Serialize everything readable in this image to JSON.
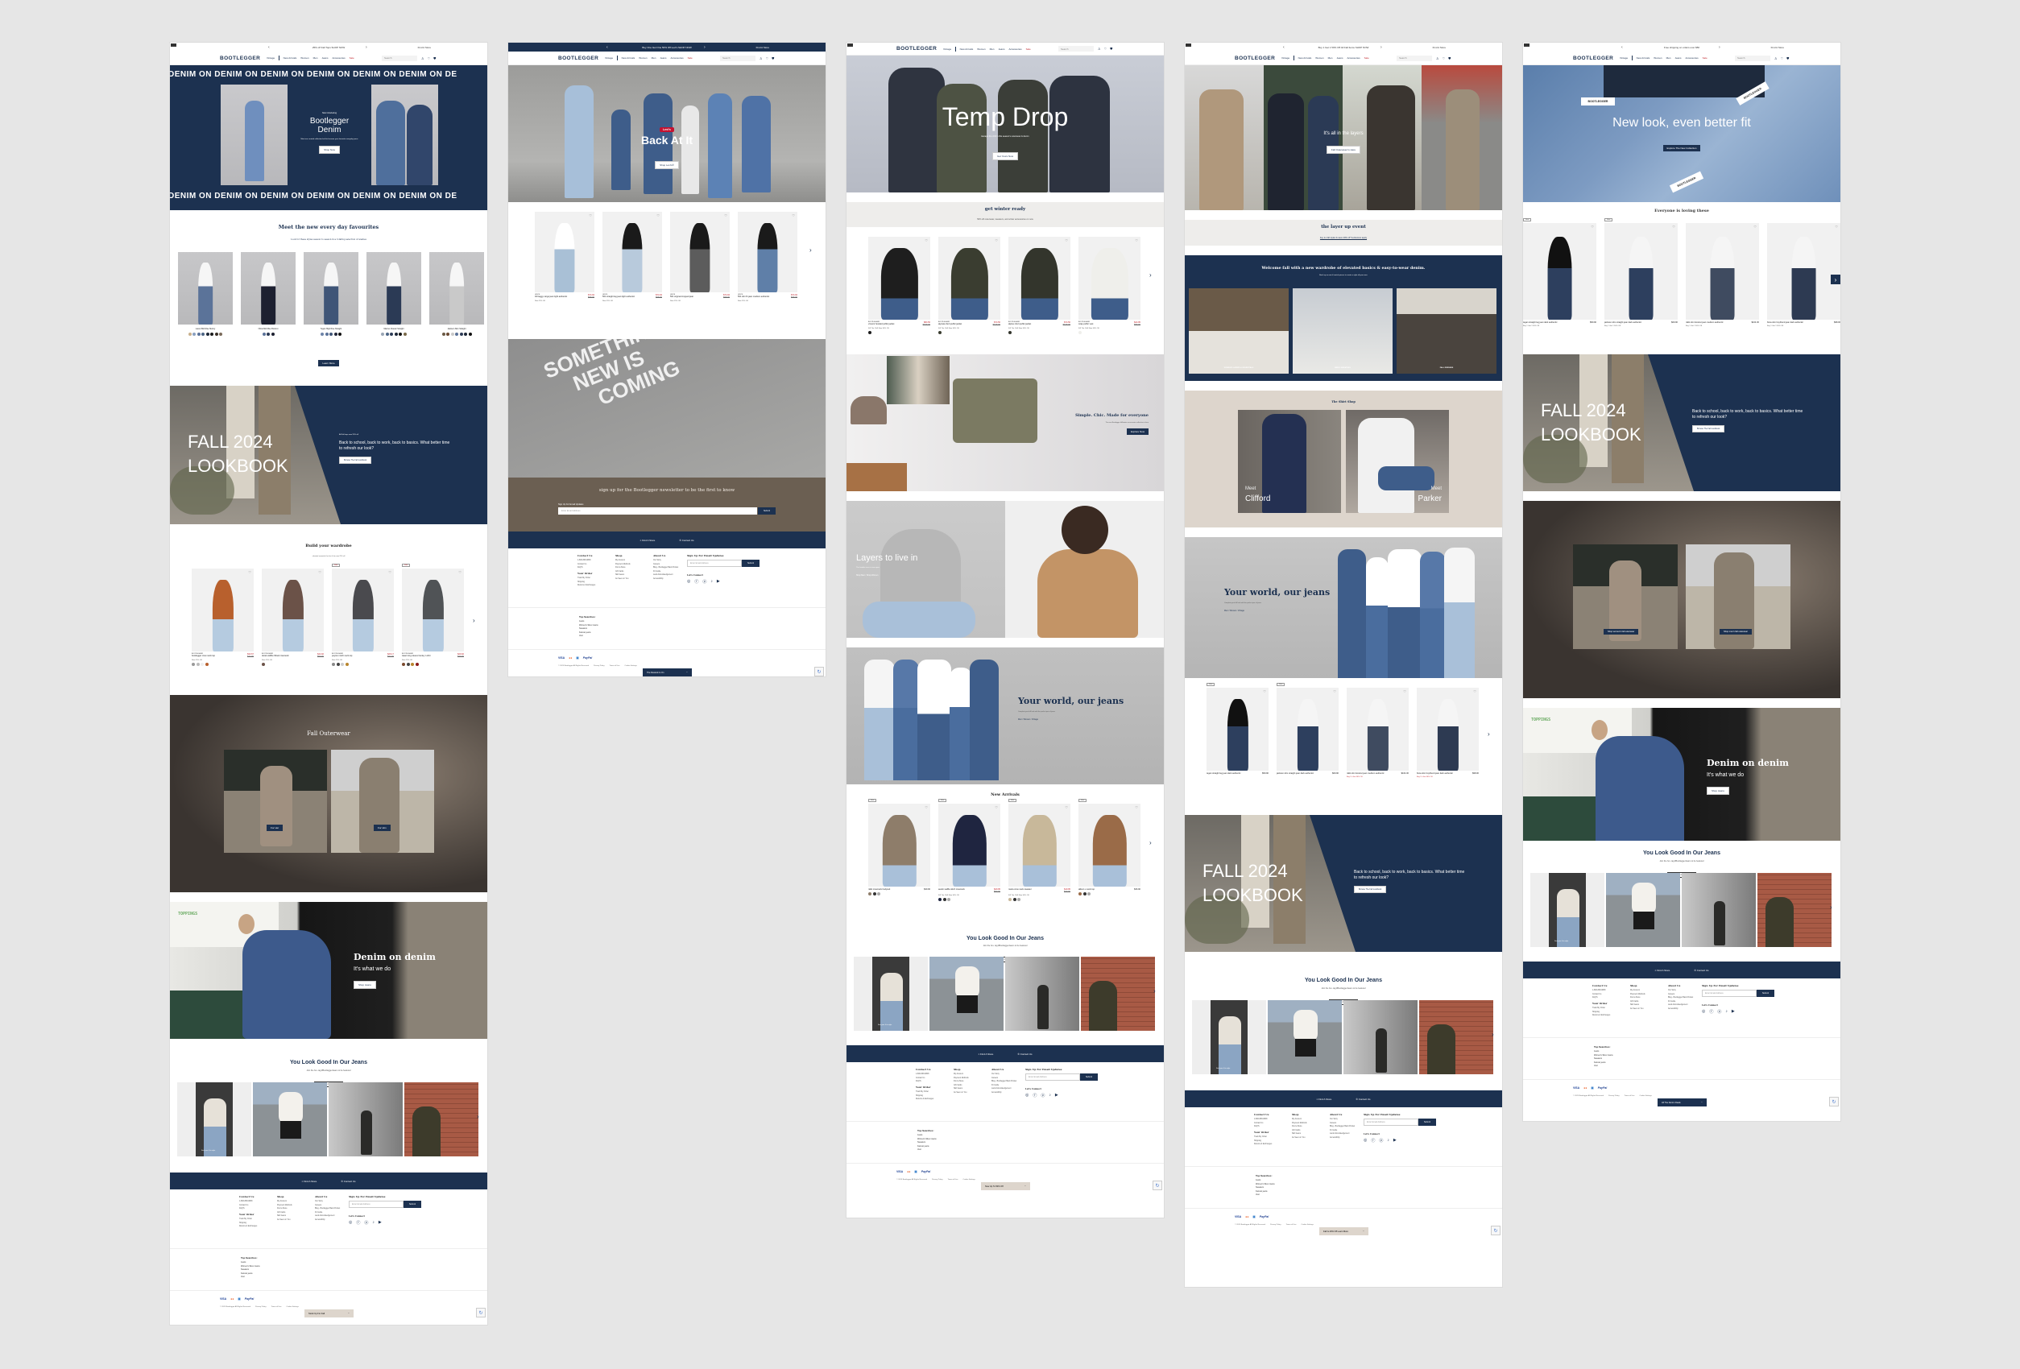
{
  "brand": {
    "name": "BOOTLEGGER",
    "navy": "#1c3150",
    "sale_red": "#c0262d",
    "taupe": "#6b5f52",
    "sand": "#ddd5cc"
  },
  "header": {
    "nav": [
      "Vintage",
      "New Arrivals",
      "Women",
      "Men",
      "Jeans",
      "Accessories",
      "Sale"
    ],
    "search_placeholder": "Search",
    "find_store": "Find A Store",
    "promos": [
      "25% off Fall Tops SHOP NOW",
      "Buy One Get One 50% Off Levi's SHOP NOW",
      "",
      "Buy 1 Get 1 50% Off All Fall Items SHOP NOW",
      "Free shipping on orders over $50"
    ]
  },
  "icons": {
    "prev": "‹",
    "next": "›",
    "heart": "♡",
    "pin": "⌖",
    "phone": "✆",
    "user": "♙",
    "bag": "⛊",
    "search": "⚲"
  },
  "panel1": {
    "marquee": "DENIM ON DENIM ON DENIM ON DENIM ON DENIM ON DENIM ON DE",
    "hero": {
      "eyebrow": "Now Introducing",
      "title_line1": "Bootlegger",
      "title_line2": "Denim",
      "sub": "Meet our curated collection built to become your favourite everyday jeans",
      "cta": "Shop Now"
    },
    "favourites": {
      "title": "Meet the new every day favourites",
      "sub": "Look for these styles season to season in a rotating selection of washes",
      "items": [
        {
          "name": "Laurel Mid Rise Skinny",
          "swatches": [
            "#c8b08c",
            "#8aa0c0",
            "#5b7399",
            "#4d6585",
            "#1d2738",
            "#1a1a1a",
            "#3a3028",
            "#7a6a5a"
          ]
        },
        {
          "name": "Olivia Mid Rise Bootcut",
          "swatches": [
            "#5b7399",
            "#2b3a55",
            "#1d2030"
          ]
        },
        {
          "name": "Tegan High Rise Straight",
          "swatches": [
            "#6d83a8",
            "#5b7399",
            "#3f5577",
            "#22263a",
            "#111111"
          ]
        },
        {
          "name": "Marcus Classic Straight",
          "swatches": [
            "#9aa6b5",
            "#4d6585",
            "#2b3a55",
            "#1d2738",
            "#111",
            "#7a6a4a"
          ]
        },
        {
          "name": "Jackson Slim Straight",
          "swatches": [
            "#6a5a44",
            "#6b4a33",
            "#c9c9c9",
            "#5b7399",
            "#2b3a55",
            "#1d2738",
            "#111"
          ]
        }
      ],
      "cta": "Learn More"
    },
    "lookbook": {
      "title_line1": "FALL 2024",
      "title_line2": "LOOKBOOK",
      "eyebrow": "All Fall tops now 25% off",
      "body": "Back to school, back to work, back to basics. What better time to refresh our look?",
      "cta": "Browse The Fall Lookbook"
    },
    "wardrobe": {
      "title": "Build your wardrobe",
      "sub": "elevated essentials for him & her now 25% off",
      "items": [
        {
          "brand": "BOOTLEGGER",
          "name": "bootlegger crew neck top",
          "price": "$33.67",
          "was": "$44.90",
          "badge": "Now 25% Off",
          "color": "#b8602d",
          "sale": false,
          "swatches": [
            "#999",
            "#bbb",
            "#eee",
            "#b8602d"
          ]
        },
        {
          "brand": "BOOTLEGGER",
          "name": "derek waffle ribbed crewneck",
          "price": "$44.92",
          "was": "$59.90",
          "badge": "Now 25% Off",
          "color": "#6b5248",
          "sale": false,
          "swatches": [
            "#6b5248"
          ]
        },
        {
          "brand": "BOOTLEGGER",
          "name": "peyton notch neck top",
          "price": "$26.17",
          "was": "$34.90",
          "badge": "Now 25% Off",
          "color": "#4a4a4e",
          "sale": true,
          "swatches": [
            "#888",
            "#444",
            "#ccc",
            "#b8862d"
          ]
        },
        {
          "brand": "BOOTLEGGER",
          "name": "isaac long sleeve henley t-shirt",
          "price": "$29.92",
          "was": "$39.90",
          "badge": "Now 25% Off",
          "color": "#505356",
          "sale": true,
          "swatches": [
            "#7a4a2d",
            "#444",
            "#b8862d",
            "#8a1a1a"
          ]
        }
      ],
      "sale_tag": "Sale"
    },
    "outerwear": {
      "title": "Fall Outerwear",
      "cta_women": "For Her",
      "cta_men": "For Him"
    },
    "denim": {
      "title": "Denim on denim",
      "sub": "It's what we do",
      "cta": "Shop Jeans"
    },
    "sticky": "Stock Up For Fall"
  },
  "panel2": {
    "hero": {
      "logo": "Levi's",
      "title": "Back At It",
      "cta": "Shop Levi's®"
    },
    "items": [
      {
        "brand": "LEVI'S",
        "name": "94 baggy cargo jean light authentic",
        "price": "$74.94",
        "was": "$98.00",
        "badge": "Now 25% Off",
        "top": "#ffffff",
        "bottom": "#a9c0d6"
      },
      {
        "brand": "LEVI'S",
        "name": "501 straight leg jean light authentic",
        "price": "$74.94",
        "was": "$98.00",
        "badge": "Now 25% Off",
        "top": "#1a1a1a",
        "bottom": "#b8cadc"
      },
      {
        "brand": "LEVI'S",
        "name": "501 original cropped jean",
        "price": "$74.94",
        "was": "$98.00",
        "badge": "Now 25% Off",
        "top": "#1a1a1a",
        "bottom": "#5c5c5c"
      },
      {
        "brand": "LEVI'S",
        "name": "501 slim fit jean medium authentic",
        "price": "$74.94",
        "was": "$98.00",
        "badge": "Now 25% Off",
        "top": "#1a1a1a",
        "bottom": "#5f7fa8"
      }
    ],
    "coming": {
      "line1": "SOMETHING",
      "line2": "NEW IS",
      "line3": "COMING"
    },
    "newsletter": {
      "title": "sign up for the Bootlegger newsletter to be the first to know",
      "label": "Sign Up For Email Updates",
      "placeholder": "Enter Email Address",
      "submit": "Submit"
    },
    "sticky": "The Restock Is On"
  },
  "panel3": {
    "hero": {
      "title": "Temp Drop",
      "sub": "Escape the chill in this season's outerwear & denim",
      "cta": "Get Yours Now"
    },
    "winter": {
      "title": "get winter ready",
      "sub": "50% off outerwear, sweaters, and winter accessories on now"
    },
    "items": [
      {
        "brand": "BOOTLEGGER",
        "name": "vincent hooded puffer jacket",
        "price": "$84.50",
        "was": "$169.00",
        "badge": "Kill The Chill Now 50% Off",
        "color": "#1e1e1e"
      },
      {
        "brand": "BOOTLEGGER",
        "name": "alyssia short puffer jacket",
        "price": "$74.50",
        "was": "$149.00",
        "badge": "Kill The Chill Now 50% Off",
        "color": "#3a3d30"
      },
      {
        "brand": "BOOTLEGGER",
        "name": "alpine short puffer jacket",
        "price": "$74.50",
        "was": "$149.00",
        "badge": "Kill The Chill Now 50% Off",
        "color": "#33352c"
      },
      {
        "brand": "BOOTLEGGER",
        "name": "wrap puffer vest",
        "price": "$44.95",
        "was": "$89.90",
        "badge": "Kill The Chill Now 50% Off",
        "color": "#efefeb"
      }
    ],
    "accessories": {
      "title": "Simple. Chic. Made for everyone",
      "sub": "The new Bootlegger fall/winter accessories collection is here",
      "cta": "Explore Now"
    },
    "layers": {
      "title": "Layers to live in",
      "sub": "The hoodie since is now open",
      "links": "Shop Men / Shop Women"
    },
    "jeans": {
      "title": "Your world, our jeans",
      "sub": "Complete your fall look with the perfect pair of jeans",
      "links": "Men / Women / Vintage"
    },
    "arrivals": {
      "title": "New Arrivals",
      "tag": "New",
      "items": [
        {
          "name": "nikki crewneck bodysuit",
          "price": "$39.90",
          "sale": false,
          "color": "#8e7d6a",
          "badge": ""
        },
        {
          "name": "austin waffle stitch crewneck",
          "price": "$29.95",
          "was": "$59.90",
          "sale": true,
          "color": "#1f2540",
          "badge": "Kill The Chill Now 50% Off"
        },
        {
          "name": "maria crew neck sweater",
          "price": "$19.95",
          "was": "$39.90",
          "sale": true,
          "color": "#c8b89a",
          "badge": "Kill The Chill Now 50% Off"
        },
        {
          "name": "allison v-neck top",
          "price": "$36.90",
          "sale": false,
          "color": "#9a6b48",
          "badge": ""
        }
      ]
    },
    "sticky": "Now Up To 50% Off"
  },
  "panel4": {
    "hero": {
      "title": "It's all in the layers",
      "cta": "Fall Outerwear Is Here"
    },
    "event": {
      "title": "the layer up event",
      "sub": "buy 2+ fall styles & save 40% off *exclusions apply"
    },
    "welcome": {
      "title": "Welcome fall with a new wardrobe of elevated basics & easy-to-wear denim.",
      "sub": "Stock up on mix & match pieces to create a style all your own.",
      "tiles": [
        "WOMEN'S LAYERS & ESSENTIALS",
        "MEN'S SWEATERS",
        "FALL DRESSES"
      ]
    },
    "shirts": {
      "title": "The Shirt Shop",
      "left_eyebrow": "Meet",
      "left_name": "Clifford",
      "right_eyebrow": "Meet",
      "right_name": "Parker"
    },
    "jeans": {
      "title": "Your world, our jeans",
      "sub": "Complete your fall look with the perfect pair of jeans",
      "links": "Men / Women / Vintage"
    },
    "items": [
      {
        "name": "tegan straight leg jean dark authentic",
        "price": "$59.90",
        "tag": "New",
        "top": "#111",
        "bottom": "#2d3f5e",
        "badge": ""
      },
      {
        "name": "jackson slim straight jean dark authentic",
        "price": "$69.90",
        "tag": "New",
        "top": "#f5f5f5",
        "bottom": "#2d3f5e",
        "badge": ""
      },
      {
        "name": "nikki slim bootcut jean medium authentic",
        "price": "$104.00",
        "tag": "",
        "top": "#f5f5f5",
        "bottom": "#3f4b60",
        "badge": "Buy 2+ Get 40% Off"
      },
      {
        "name": "fiona slim boyfriend jean dark authentic",
        "price": "$98.00",
        "tag": "",
        "top": "#f5f5f5",
        "bottom": "#2d3a52",
        "badge": "Buy 2+ Get 40% Off"
      }
    ],
    "lookbook": {
      "title_line1": "FALL 2024",
      "title_line2": "LOOKBOOK",
      "body": "Back to school, back to work, back to basics. What better time to refresh our look?",
      "cta": "Browse The Fall Lookbook"
    },
    "sticky": "Fall Is 40% Off Learn More"
  },
  "panel5": {
    "hero": {
      "title": "New look, even better fit",
      "cta": "Explore The New Collection"
    },
    "loving": {
      "title": "Everyone is loving these",
      "items": [
        {
          "name": "tegan straight leg jean dark authentic",
          "price": "$59.90",
          "tag": "New",
          "badge": "Buy 1 Get 1 50% Off",
          "top": "#111",
          "bottom": "#2d3f5e"
        },
        {
          "name": "jackson slim straight jean dark authentic",
          "price": "$69.90",
          "tag": "New",
          "badge": "Buy 1 Get 1 50% Off",
          "top": "#f5f5f5",
          "bottom": "#2d3f5e"
        },
        {
          "name": "nikki slim bootcut jean medium authentic",
          "price": "$104.00",
          "tag": "",
          "badge": "Buy 1 Get 1 50% Off",
          "top": "#f5f5f5",
          "bottom": "#3f4b60"
        },
        {
          "name": "fiona slim boyfriend jean dark authentic",
          "price": "$98.00",
          "tag": "",
          "badge": "Buy 1 Get 1 50% Off",
          "top": "#f5f5f5",
          "bottom": "#2d3a52"
        }
      ]
    },
    "lookbook": {
      "title_line1": "FALL 2024",
      "title_line2": "LOOKBOOK",
      "body": "Back to school, back to work, back to basics. What better time to refresh our look?",
      "cta": "Browse The Fall Lookbook"
    },
    "outerwear": {
      "cta_women": "Shop women's fall outerwear",
      "cta_men": "Shop men's fall outerwear"
    },
    "denim": {
      "title": "Denim on denim",
      "sub": "It's what we do",
      "cta": "Shop Jeans"
    },
    "sticky": "All The Denim Deals"
  },
  "ugc": {
    "title": "You Look Good In Our Jeans",
    "sub": "Join the fun- tag #BootleggerJeans to be featured",
    "cta": "View Gallery",
    "overlay": "Find your fit in style"
  },
  "footer": {
    "bar": {
      "find_store": "Find A Store",
      "contact": "Contact Us"
    },
    "contact": {
      "title": "Contact Us",
      "links": [
        "1-800-808-0808",
        "Contact Us",
        "FAQ'S"
      ]
    },
    "order": {
      "title": "Your Order",
      "links": [
        "Track My Order",
        "Shipping",
        "Returns & Exchanges"
      ]
    },
    "shop": {
      "title": "Shop",
      "links": [
        "My Account",
        "Payment Methods",
        "Find a Store",
        "Gift Cards",
        "Skill Jeans",
        "As Seen on You"
      ]
    },
    "about": {
      "title": "About Us",
      "links": [
        "Our Story",
        "Careers",
        "Blog - Bootlegger Back Pocket",
        "Fit Guide",
        "Land Acknowledgement",
        "Accessibility"
      ]
    },
    "signup": {
      "title": "Sign Up For Email Updates",
      "placeholder": "Enter Email Address",
      "submit": "Submit"
    },
    "connect": {
      "title": "Let's Connect",
      "icons": [
        "◎",
        "ⓕ",
        "ⓟ",
        "♪",
        "▶"
      ]
    },
    "top_searches": {
      "title": "Top Searches:",
      "links": [
        "Jeans",
        "Women's Silver Jeans",
        "Sweaters",
        "Kancan jeans",
        "Vest"
      ]
    },
    "payments": [
      "VISA",
      "●●",
      "▣",
      "PayPal"
    ],
    "legal": [
      "© 2025 Bootlegger All Rights Reserved",
      "Privacy Policy",
      "Terms of Use",
      "Cookie Settings"
    ]
  }
}
